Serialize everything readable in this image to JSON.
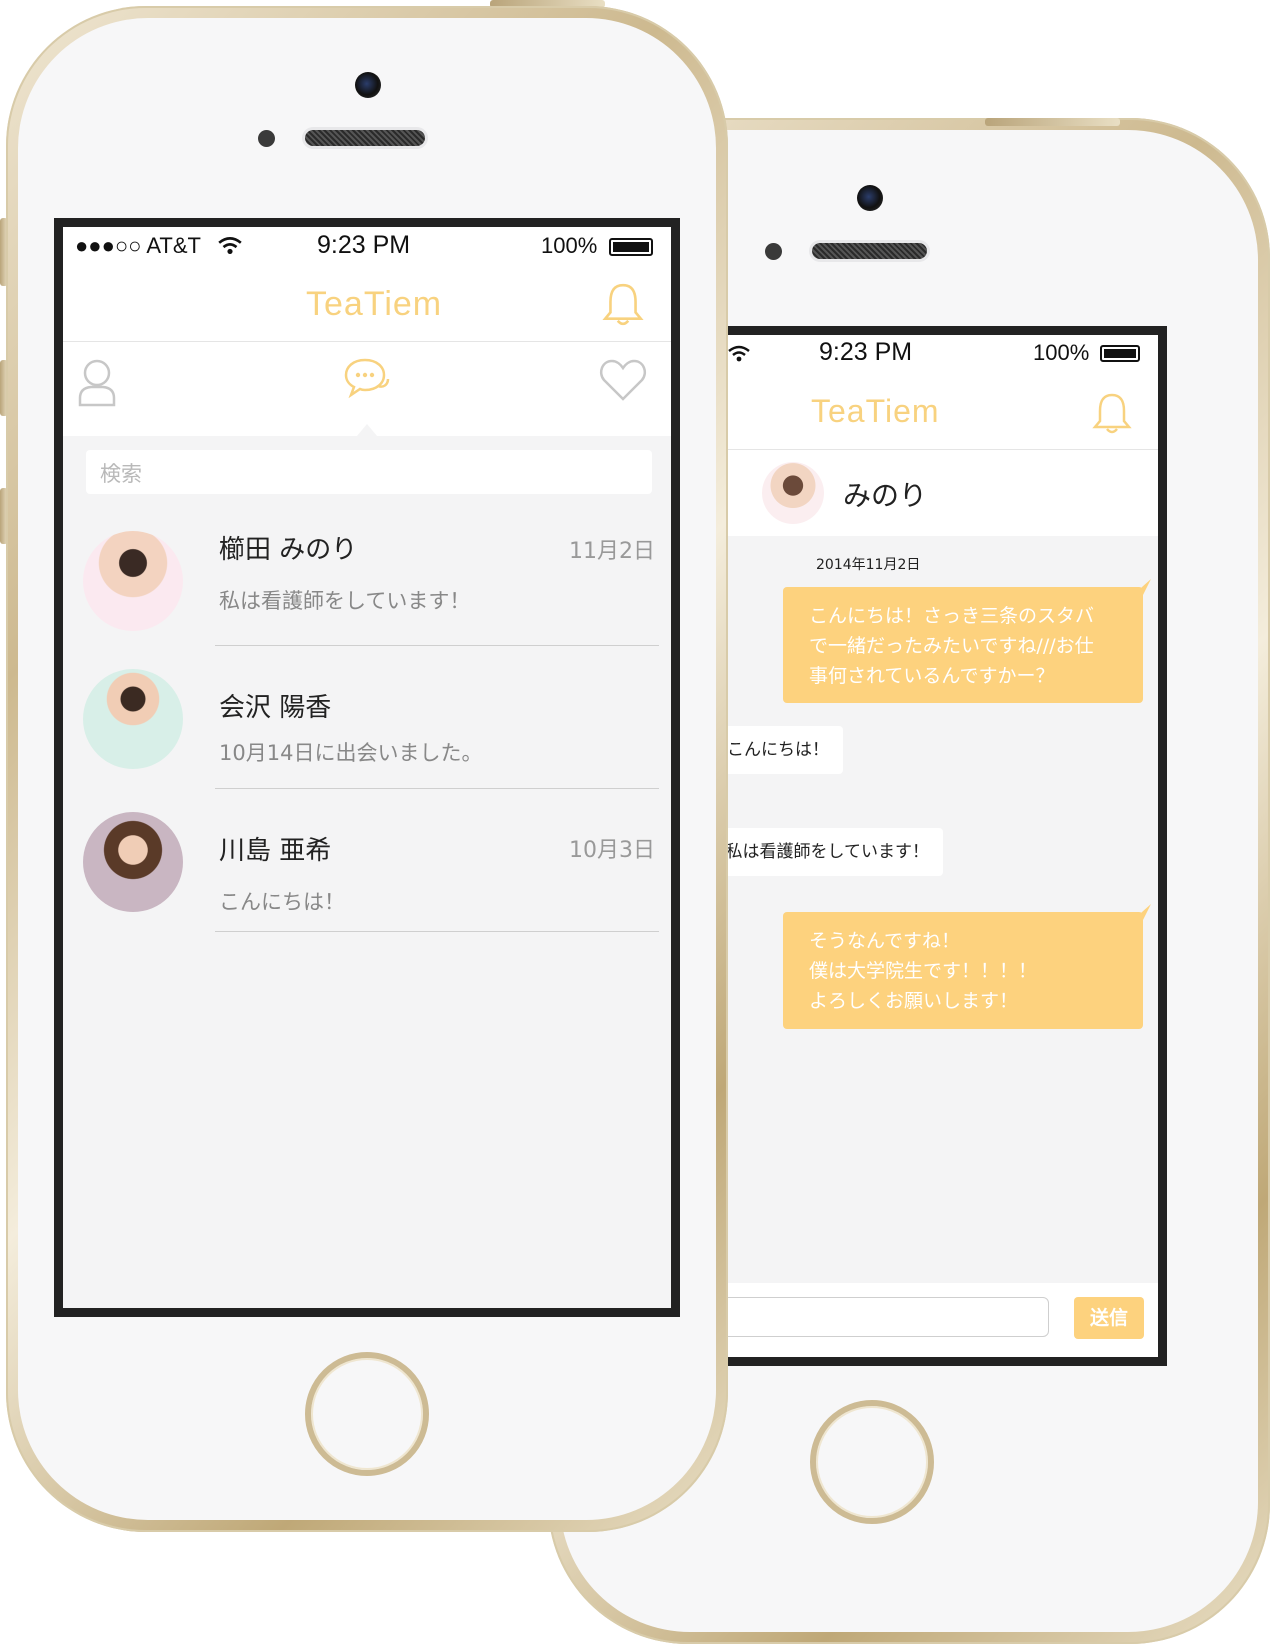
{
  "colors": {
    "accent": "#f8d27f",
    "bubble": "#fdd27e",
    "list_bg": "#f4f4f5"
  },
  "left_phone": {
    "status": {
      "carrier": "●●●○○ AT&T",
      "time": "9:23 PM",
      "battery": "100%"
    },
    "app_title": "TeaTiem",
    "tabs": {
      "profile_icon": "person-icon",
      "chat_icon": "chat-bubbles-icon",
      "favorites_icon": "heart-icon"
    },
    "search": {
      "placeholder": "検索"
    },
    "conversations": [
      {
        "name": "櫛田 みのり",
        "date": "11月2日",
        "preview": "私は看護師をしています！"
      },
      {
        "name": "会沢 陽香",
        "date": "",
        "preview": "10月14日に出会いました。"
      },
      {
        "name": "川島 亜希",
        "date": "10月3日",
        "preview": "こんにちは！"
      }
    ]
  },
  "right_phone": {
    "status": {
      "time": "9:23 PM",
      "battery": "100%"
    },
    "app_title": "TeaTiem",
    "chat_partner": "みのり",
    "chat_date": "2014年11月2日",
    "messages": [
      {
        "dir": "out",
        "lines": [
          "こんにちは！さっき三条のスタバ",
          "で一緒だったみたいですね///お仕",
          "事何されているんですかー？"
        ]
      },
      {
        "dir": "in",
        "text": "こんにちは！"
      },
      {
        "dir": "in",
        "text": "私は看護師をしています！"
      },
      {
        "dir": "out",
        "lines": [
          "そうなんですね！",
          "僕は大学院生です！！！！",
          "よろしくお願いします！"
        ]
      }
    ],
    "input": {
      "value": ""
    },
    "send_label": "送信"
  }
}
